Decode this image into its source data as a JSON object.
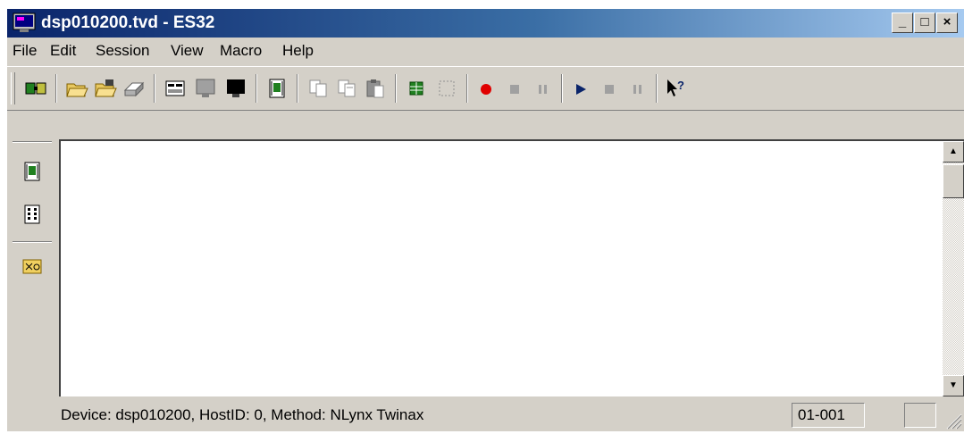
{
  "window": {
    "title": "dsp010200.tvd - ES32"
  },
  "caption_buttons": {
    "minimize": "_",
    "maximize": "□",
    "close": "×"
  },
  "menu": [
    {
      "label": "File"
    },
    {
      "label": "Edit"
    },
    {
      "label": "Session"
    },
    {
      "label": "View"
    },
    {
      "label": "Macro"
    },
    {
      "label": "Help"
    }
  ],
  "toolbar": {
    "buttons": [
      {
        "icon": "connect-icon"
      },
      {
        "icon": "open-folder-icon"
      },
      {
        "icon": "open-session-icon"
      },
      {
        "icon": "print-icon"
      },
      {
        "icon": "print-screen-icon"
      },
      {
        "icon": "screen-gray-icon"
      },
      {
        "icon": "screen-black-icon"
      },
      {
        "icon": "display-panel-icon"
      },
      {
        "icon": "copy-icon"
      },
      {
        "icon": "copy-append-icon"
      },
      {
        "icon": "paste-icon"
      },
      {
        "icon": "green-grid-icon"
      },
      {
        "icon": "select-all-icon"
      },
      {
        "icon": "record-icon"
      },
      {
        "icon": "stop-record-icon"
      },
      {
        "icon": "pause-record-icon"
      },
      {
        "icon": "play-icon"
      },
      {
        "icon": "stop-play-icon"
      },
      {
        "icon": "pause-play-icon"
      },
      {
        "icon": "context-help-icon"
      }
    ]
  },
  "left_toolbar": [
    {
      "icon": "display-panel-icon"
    },
    {
      "icon": "keypad-panel-icon"
    },
    {
      "icon": "hotspot-icon"
    }
  ],
  "status": {
    "device_text": "Device: dsp010200, HostID: 0, Method: NLynx Twinax",
    "cursor_position": "01-001",
    "indicator": ""
  },
  "colors": {
    "titlebar_start": "#0a246a",
    "titlebar_end": "#a6caf0",
    "face": "#d4d0c8",
    "record": "#e00000",
    "play": "#0a246a"
  }
}
